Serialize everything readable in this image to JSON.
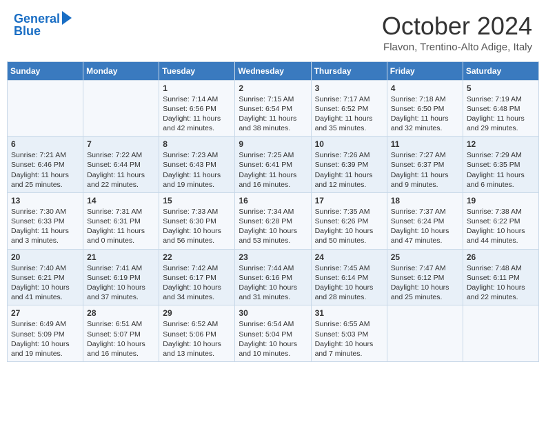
{
  "header": {
    "logo_line1": "General",
    "logo_line2": "Blue",
    "title": "October 2024",
    "subtitle": "Flavon, Trentino-Alto Adige, Italy"
  },
  "calendar": {
    "days_of_week": [
      "Sunday",
      "Monday",
      "Tuesday",
      "Wednesday",
      "Thursday",
      "Friday",
      "Saturday"
    ],
    "weeks": [
      [
        {
          "day": "",
          "info": ""
        },
        {
          "day": "",
          "info": ""
        },
        {
          "day": "1",
          "info": "Sunrise: 7:14 AM\nSunset: 6:56 PM\nDaylight: 11 hours and 42 minutes."
        },
        {
          "day": "2",
          "info": "Sunrise: 7:15 AM\nSunset: 6:54 PM\nDaylight: 11 hours and 38 minutes."
        },
        {
          "day": "3",
          "info": "Sunrise: 7:17 AM\nSunset: 6:52 PM\nDaylight: 11 hours and 35 minutes."
        },
        {
          "day": "4",
          "info": "Sunrise: 7:18 AM\nSunset: 6:50 PM\nDaylight: 11 hours and 32 minutes."
        },
        {
          "day": "5",
          "info": "Sunrise: 7:19 AM\nSunset: 6:48 PM\nDaylight: 11 hours and 29 minutes."
        }
      ],
      [
        {
          "day": "6",
          "info": "Sunrise: 7:21 AM\nSunset: 6:46 PM\nDaylight: 11 hours and 25 minutes."
        },
        {
          "day": "7",
          "info": "Sunrise: 7:22 AM\nSunset: 6:44 PM\nDaylight: 11 hours and 22 minutes."
        },
        {
          "day": "8",
          "info": "Sunrise: 7:23 AM\nSunset: 6:43 PM\nDaylight: 11 hours and 19 minutes."
        },
        {
          "day": "9",
          "info": "Sunrise: 7:25 AM\nSunset: 6:41 PM\nDaylight: 11 hours and 16 minutes."
        },
        {
          "day": "10",
          "info": "Sunrise: 7:26 AM\nSunset: 6:39 PM\nDaylight: 11 hours and 12 minutes."
        },
        {
          "day": "11",
          "info": "Sunrise: 7:27 AM\nSunset: 6:37 PM\nDaylight: 11 hours and 9 minutes."
        },
        {
          "day": "12",
          "info": "Sunrise: 7:29 AM\nSunset: 6:35 PM\nDaylight: 11 hours and 6 minutes."
        }
      ],
      [
        {
          "day": "13",
          "info": "Sunrise: 7:30 AM\nSunset: 6:33 PM\nDaylight: 11 hours and 3 minutes."
        },
        {
          "day": "14",
          "info": "Sunrise: 7:31 AM\nSunset: 6:31 PM\nDaylight: 11 hours and 0 minutes."
        },
        {
          "day": "15",
          "info": "Sunrise: 7:33 AM\nSunset: 6:30 PM\nDaylight: 10 hours and 56 minutes."
        },
        {
          "day": "16",
          "info": "Sunrise: 7:34 AM\nSunset: 6:28 PM\nDaylight: 10 hours and 53 minutes."
        },
        {
          "day": "17",
          "info": "Sunrise: 7:35 AM\nSunset: 6:26 PM\nDaylight: 10 hours and 50 minutes."
        },
        {
          "day": "18",
          "info": "Sunrise: 7:37 AM\nSunset: 6:24 PM\nDaylight: 10 hours and 47 minutes."
        },
        {
          "day": "19",
          "info": "Sunrise: 7:38 AM\nSunset: 6:22 PM\nDaylight: 10 hours and 44 minutes."
        }
      ],
      [
        {
          "day": "20",
          "info": "Sunrise: 7:40 AM\nSunset: 6:21 PM\nDaylight: 10 hours and 41 minutes."
        },
        {
          "day": "21",
          "info": "Sunrise: 7:41 AM\nSunset: 6:19 PM\nDaylight: 10 hours and 37 minutes."
        },
        {
          "day": "22",
          "info": "Sunrise: 7:42 AM\nSunset: 6:17 PM\nDaylight: 10 hours and 34 minutes."
        },
        {
          "day": "23",
          "info": "Sunrise: 7:44 AM\nSunset: 6:16 PM\nDaylight: 10 hours and 31 minutes."
        },
        {
          "day": "24",
          "info": "Sunrise: 7:45 AM\nSunset: 6:14 PM\nDaylight: 10 hours and 28 minutes."
        },
        {
          "day": "25",
          "info": "Sunrise: 7:47 AM\nSunset: 6:12 PM\nDaylight: 10 hours and 25 minutes."
        },
        {
          "day": "26",
          "info": "Sunrise: 7:48 AM\nSunset: 6:11 PM\nDaylight: 10 hours and 22 minutes."
        }
      ],
      [
        {
          "day": "27",
          "info": "Sunrise: 6:49 AM\nSunset: 5:09 PM\nDaylight: 10 hours and 19 minutes."
        },
        {
          "day": "28",
          "info": "Sunrise: 6:51 AM\nSunset: 5:07 PM\nDaylight: 10 hours and 16 minutes."
        },
        {
          "day": "29",
          "info": "Sunrise: 6:52 AM\nSunset: 5:06 PM\nDaylight: 10 hours and 13 minutes."
        },
        {
          "day": "30",
          "info": "Sunrise: 6:54 AM\nSunset: 5:04 PM\nDaylight: 10 hours and 10 minutes."
        },
        {
          "day": "31",
          "info": "Sunrise: 6:55 AM\nSunset: 5:03 PM\nDaylight: 10 hours and 7 minutes."
        },
        {
          "day": "",
          "info": ""
        },
        {
          "day": "",
          "info": ""
        }
      ]
    ]
  }
}
